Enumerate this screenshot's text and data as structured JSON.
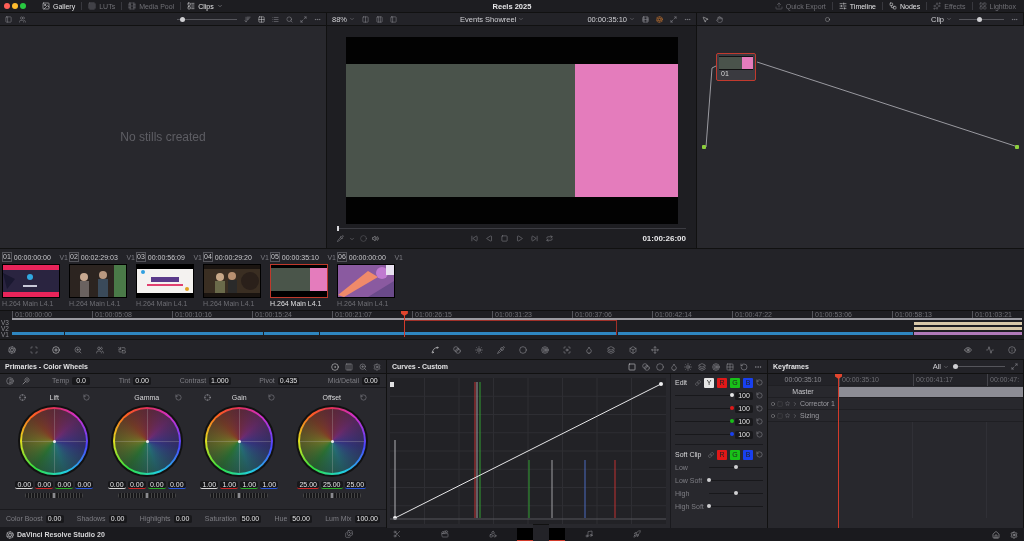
{
  "menu_bar": {
    "left_tabs": [
      {
        "kind": "gallery",
        "label": "Gallery",
        "active": true
      },
      {
        "kind": "luts",
        "label": "LUTs",
        "active": false
      },
      {
        "kind": "media_pool",
        "label": "Media Pool",
        "active": false
      },
      {
        "kind": "clips",
        "label": "Clips",
        "active": true
      }
    ],
    "title": "Reels 2025",
    "right_tabs": [
      {
        "kind": "quick_export",
        "label": "Quick Export",
        "active": false
      },
      {
        "kind": "timeline",
        "label": "Timeline",
        "active": true
      },
      {
        "kind": "nodes",
        "label": "Nodes",
        "active": true
      },
      {
        "kind": "effects",
        "label": "Effects",
        "active": false
      },
      {
        "kind": "lightbox",
        "label": "Lightbox",
        "active": false
      }
    ]
  },
  "toolbar": {
    "gallery_zoom": {
      "level": 0.08
    },
    "viewer_zoom": "88%",
    "timeline_name": "Events Showreel",
    "timecode": "00:00:35:10",
    "node_mode": "Clip",
    "node_zoom": {
      "level": 0.45
    }
  },
  "gallery": {
    "message": "No stills created"
  },
  "viewer": {
    "scrub": {
      "level": 0
    },
    "timecode": "01:00:26:00"
  },
  "node_graph": {
    "nodes": [
      {
        "label": "01",
        "selected": true
      }
    ]
  },
  "clips": [
    {
      "number": "01",
      "timecode": "00:00:00:00",
      "track": "V1",
      "codec": "H.264 Main L4.1",
      "selected": false
    },
    {
      "number": "02",
      "timecode": "00:02:29:03",
      "track": "V1",
      "codec": "H.264 Main L4.1",
      "selected": false
    },
    {
      "number": "03",
      "timecode": "00:00:56:09",
      "track": "V1",
      "codec": "H.264 Main L4.1",
      "selected": false
    },
    {
      "number": "04",
      "timecode": "00:00:29:20",
      "track": "V1",
      "codec": "H.264 Main L4.1",
      "selected": false
    },
    {
      "number": "05",
      "timecode": "00:00:35:10",
      "track": "V1",
      "codec": "H.264 Main L4.1",
      "selected": true
    },
    {
      "number": "06",
      "timecode": "00:00:00:00",
      "track": "V1",
      "codec": "H.264 Main L4.1",
      "selected": false
    }
  ],
  "mini_timeline": {
    "tracks": [
      "V3",
      "V2",
      "V1"
    ],
    "ticks": [
      "01:00:00:00",
      "01:00:05:08",
      "01:00:10:16",
      "01:00:15:24",
      "01:00:21:07",
      "01:00:26:15",
      "01:00:31:23",
      "01:00:37:06",
      "01:00:42:14",
      "01:00:47:22",
      "01:00:53:06",
      "01:00:58:13",
      "01:01:03:21"
    ]
  },
  "primaries": {
    "title": "Primaries - Color Wheels",
    "top_params": [
      {
        "label": "Temp",
        "value": "0.0"
      },
      {
        "label": "Tint",
        "value": "0.00"
      },
      {
        "label": "Contrast",
        "value": "1.000"
      },
      {
        "label": "Pivot",
        "value": "0.435"
      },
      {
        "label": "Mid/Detail",
        "value": "0.00"
      }
    ],
    "wheels": [
      {
        "label": "Lift",
        "picker": true,
        "master": {
          "level": 0.5
        },
        "values": [
          {
            "value": "0.00",
            "color": "#d8d8d8"
          },
          {
            "value": "0.00",
            "color": "#d02828"
          },
          {
            "value": "0.00",
            "color": "#28b028"
          },
          {
            "value": "0.00",
            "color": "#2858e0"
          }
        ]
      },
      {
        "label": "Gamma",
        "picker": false,
        "master": {
          "level": 0.5
        },
        "values": [
          {
            "value": "0.00",
            "color": "#d8d8d8"
          },
          {
            "value": "0.00",
            "color": "#d02828"
          },
          {
            "value": "0.00",
            "color": "#28b028"
          },
          {
            "value": "0.00",
            "color": "#2858e0"
          }
        ]
      },
      {
        "label": "Gain",
        "picker": true,
        "master": {
          "level": 0.5
        },
        "values": [
          {
            "value": "1.00",
            "color": "#d8d8d8"
          },
          {
            "value": "1.00",
            "color": "#d02828"
          },
          {
            "value": "1.00",
            "color": "#28b028"
          },
          {
            "value": "1.00",
            "color": "#2858e0"
          }
        ]
      },
      {
        "label": "Offset",
        "picker": false,
        "master": {
          "level": 0.5
        },
        "values": [
          {
            "value": "25.00",
            "color": "#d02828"
          },
          {
            "value": "25.00",
            "color": "#28b028"
          },
          {
            "value": "25.00",
            "color": "#2858e0"
          }
        ]
      }
    ],
    "bottom_params": [
      {
        "label": "Color Boost",
        "value": "0.00"
      },
      {
        "label": "Shadows",
        "value": "0.00"
      },
      {
        "label": "Highlights",
        "value": "0.00"
      },
      {
        "label": "Saturation",
        "value": "50.00"
      },
      {
        "label": "Hue",
        "value": "50.00"
      },
      {
        "label": "Lum Mix",
        "value": "100.00"
      }
    ]
  },
  "curves": {
    "title": "Curves - Custom"
  },
  "curve_edit": {
    "title": "Edit",
    "channels": [
      {
        "label": "Y",
        "color": "#e6e6e6"
      },
      {
        "label": "R",
        "color": "#e01818"
      },
      {
        "label": "G",
        "color": "#18c018"
      },
      {
        "label": "B",
        "color": "#1840f0"
      }
    ],
    "intensity": [
      {
        "value": "100",
        "color": "#e6e6e6",
        "level": 1
      },
      {
        "value": "100",
        "color": "#e01818",
        "level": 1
      },
      {
        "value": "100",
        "color": "#18c018",
        "level": 1
      },
      {
        "value": "100",
        "color": "#1840f0",
        "level": 1
      }
    ],
    "soft_clip": {
      "title": "Soft Clip",
      "channels": [
        {
          "label": "R",
          "color": "#e01818"
        },
        {
          "label": "G",
          "color": "#18c018"
        },
        {
          "label": "B",
          "color": "#1840f0"
        }
      ],
      "sliders": [
        {
          "label": "Low",
          "level": 0.5
        },
        {
          "label": "Low Soft",
          "level": 0
        },
        {
          "label": "High",
          "level": 0.5
        },
        {
          "label": "High Soft",
          "level": 0
        }
      ]
    }
  },
  "keyframes": {
    "title": "Keyframes",
    "filter": "All",
    "zoom": {
      "level": 0
    },
    "timecode": "00:00:35:10",
    "ruler": [
      "00:00:35:10",
      "00:00:41:17",
      "00:00:47:"
    ],
    "tracks": [
      {
        "kind": "master",
        "label": "Master"
      },
      {
        "kind": "node",
        "label": "Corrector 1",
        "expanded": false
      },
      {
        "kind": "node",
        "label": "Sizing",
        "expanded": false
      }
    ]
  },
  "bottom_bar": {
    "app_name": "DaVinci Resolve Studio 20",
    "pages": [
      {
        "kind": "media",
        "selected": false
      },
      {
        "kind": "cut",
        "selected": false
      },
      {
        "kind": "edit",
        "selected": false
      },
      {
        "kind": "fusion",
        "selected": false
      },
      {
        "kind": "color",
        "selected": true
      },
      {
        "kind": "fairlight",
        "selected": false
      },
      {
        "kind": "deliver",
        "selected": false
      }
    ]
  }
}
